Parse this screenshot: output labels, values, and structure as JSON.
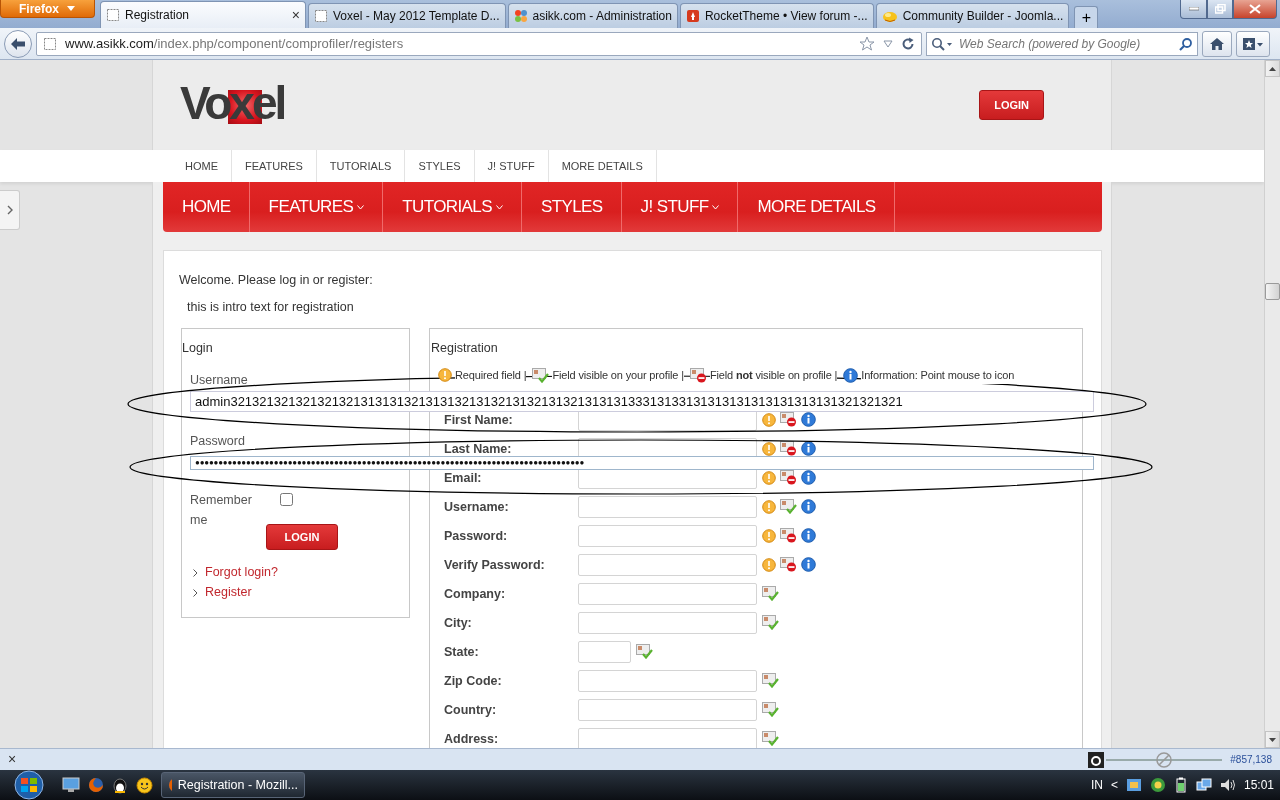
{
  "browser": {
    "menu_button": "Firefox",
    "tabs": [
      {
        "label": "Registration",
        "selected": true,
        "kind": "blank",
        "close": "×"
      },
      {
        "label": "Voxel - May 2012 Template D...",
        "selected": false,
        "kind": "blank"
      },
      {
        "label": "asikk.com - Administration",
        "selected": false,
        "kind": "joomla"
      },
      {
        "label": "RocketTheme • View forum -...",
        "selected": false,
        "kind": "rocket"
      },
      {
        "label": "Community Builder - Joomla...",
        "selected": false,
        "kind": "cb"
      }
    ],
    "new_tab": "+",
    "url_host": "www.asikk.com",
    "url_path": "/index.php/component/comprofiler/registers",
    "search_placeholder": "Web Search (powered by Google)"
  },
  "site": {
    "logo": "Voxel",
    "login_button": "LOGIN",
    "top_menu": [
      "HOME",
      "FEATURES",
      "TUTORIALS",
      "STYLES",
      "J! STUFF",
      "MORE DETAILS"
    ],
    "main_menu": [
      {
        "label": "HOME",
        "dropdown": false
      },
      {
        "label": "FEATURES",
        "dropdown": true
      },
      {
        "label": "TUTORIALS",
        "dropdown": true
      },
      {
        "label": "STYLES",
        "dropdown": false
      },
      {
        "label": "J! STUFF",
        "dropdown": true
      },
      {
        "label": "MORE DETAILS",
        "dropdown": false
      }
    ]
  },
  "welcome": "Welcome. Please log in or register:",
  "intro": "this is intro text for registration",
  "login": {
    "title": "Login",
    "username_label": "Username",
    "username_value": "admin321321321321321321313131321313132131321313213132131313133313133131313131313131313131321321321",
    "password_label": "Password",
    "password_value": "●●●●●●●●●●●●●●●●●●●●●●●●●●●●●●●●●●●●●●●●●●●●●●●●●●●●●●●●●●●●●●●●●●●●●●●●●●●●●●●●●●●●",
    "remember_label": "Remember me",
    "remember_checked": false,
    "button": "LOGIN",
    "links": [
      "Forgot login?",
      "Register"
    ]
  },
  "registration": {
    "title": "Registration",
    "legend": [
      {
        "kind": "required",
        "text": "Required field |"
      },
      {
        "kind": "visible",
        "text": "Field visible on your profile |"
      },
      {
        "kind": "hidden",
        "text": "Field **not** visible on profile |"
      },
      {
        "kind": "info",
        "text": "Information: Point mouse to icon"
      }
    ],
    "fields": [
      {
        "label": "First Name:",
        "kind": "wide",
        "required": true,
        "on_profile": false,
        "info": true
      },
      {
        "label": "Last Name:",
        "kind": "wide",
        "required": true,
        "on_profile": false,
        "info": true
      },
      {
        "label": "Email:",
        "kind": "wide",
        "required": true,
        "on_profile": false,
        "info": true
      },
      {
        "label": "Username:",
        "kind": "wide",
        "required": true,
        "on_profile": true,
        "info": true
      },
      {
        "label": "Password:",
        "kind": "wide",
        "required": true,
        "on_profile": false,
        "info": true
      },
      {
        "label": "Verify Password:",
        "kind": "wide",
        "required": true,
        "on_profile": false,
        "info": true
      },
      {
        "label": "Company:",
        "kind": "wide",
        "required": false,
        "on_profile": true,
        "info": false
      },
      {
        "label": "City:",
        "kind": "wide",
        "required": false,
        "on_profile": true,
        "info": false
      },
      {
        "label": "State:",
        "kind": "short",
        "required": false,
        "on_profile": true,
        "info": false
      },
      {
        "label": "Zip Code:",
        "kind": "wide",
        "required": false,
        "on_profile": true,
        "info": false
      },
      {
        "label": "Country:",
        "kind": "wide",
        "required": false,
        "on_profile": true,
        "info": false
      },
      {
        "label": "Address:",
        "kind": "wide",
        "required": false,
        "on_profile": true,
        "info": false
      }
    ]
  },
  "status_bar": {
    "close": "×",
    "coords": "#857,138"
  },
  "taskbar": {
    "task": "Registration - Mozill...",
    "language": "IN",
    "tray_expand": "<",
    "time": "15:01"
  }
}
